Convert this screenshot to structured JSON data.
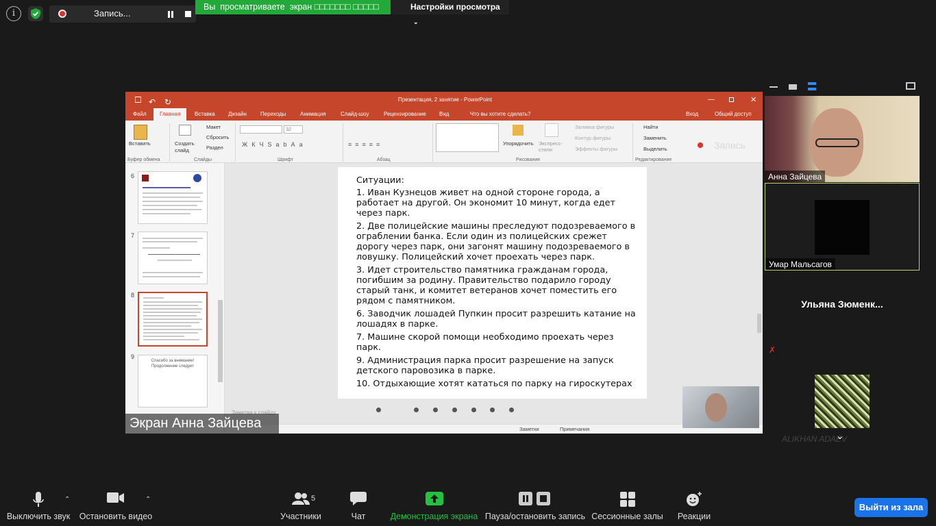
{
  "topbar": {
    "recording_label": "Запись...",
    "share_banner": "Вы  просматриваете  экран ",
    "share_banner_redacted": "□□□□□□□ □□□□□",
    "view_options": "Настройки просмотра"
  },
  "powerpoint": {
    "title": "Презентация, 2 занятие - PowerPoint",
    "tabs": [
      "Файл",
      "Главная",
      "Вставка",
      "Дизайн",
      "Переходы",
      "Анимация",
      "Слайд-шоу",
      "Рецензирование",
      "Вид",
      "Что вы хотите сделать?"
    ],
    "account": [
      "Вход",
      "Общий доступ"
    ],
    "ribbon": {
      "paste": "Вставить",
      "new_slide": "Создать слайд",
      "layout": "Макет",
      "reset": "Сбросить",
      "section": "Раздел",
      "font_size": "32",
      "arrange": "Упорядочить",
      "quick_styles": "Экспресс-стили",
      "shape_fill": "Заливка фигуры",
      "shape_outline": "Контур фигуры",
      "shape_effects": "Эффекты фигуры",
      "find": "Найти",
      "replace": "Заменить",
      "select": "Выделить",
      "groups": [
        "Буфер обмена",
        "Слайды",
        "Шрифт",
        "Абзац",
        "Рисование",
        "Редактирование"
      ],
      "record_overlay": "Запись"
    },
    "thumbnails": [
      {
        "num": "6"
      },
      {
        "num": "7"
      },
      {
        "num": "8",
        "selected": true
      },
      {
        "num": "9",
        "text": "Спасибо за внимание!\nПродолжение следует"
      }
    ],
    "slide": {
      "heading": "Ситуации:",
      "items": [
        "1. Иван Кузнецов живет на одной стороне города, а работает на другой. Он экономит 10 минут, когда едет через парк.",
        "2. Две полицейские машины преследуют подозреваемого в ограблении банка. Если один из полицейских срежет дорогу через парк, они загонят машину подозреваемого в ловушку. Полицейский хочет проехать через парк.",
        "3. Идет строительство памятника гражданам города, погибшим за родину. Правительство подарило городу старый танк, и комитет ветеранов хочет поместить его рядом с памятником.",
        "6. Заводчик лошадей Пупкин просит разрешить катание на лошадях в парке.",
        "7. Машине скорой помощи необходимо проехать через парк.",
        "9. Администрация парка просит разрешение на запуск детского паровозика в парке.",
        "10. Отдыхающие хотят кататься по парку на гироскутерах"
      ]
    },
    "notes_placeholder": "Заметки к слайду",
    "status": [
      "Заметки",
      "Примечания"
    ]
  },
  "screen_label": "Экран Анна Зайцева",
  "participants_panel": {
    "tiles": [
      {
        "name": "Анна Зайцева"
      },
      {
        "name": "Умар Мальсагов"
      },
      {
        "name": "Ульяна  Зюменк..."
      },
      {
        "name": "ALIKHAN  ADAEV"
      }
    ]
  },
  "toolbar": {
    "mute": "Выключить звук",
    "video": "Остановить видео",
    "participants": "Участники",
    "participants_count": "5",
    "chat": "Чат",
    "share": "Демонстрация экрана",
    "record": "Пауза/остановить запись",
    "breakout": "Сессионные залы",
    "reactions": "Реакции",
    "leave": "Выйти из зала"
  },
  "colors": {
    "share_green": "#23a83a",
    "powerpoint_red": "#c5462a",
    "leave_blue": "#1a73e8",
    "active_speaker_border": "#b7d36a"
  }
}
